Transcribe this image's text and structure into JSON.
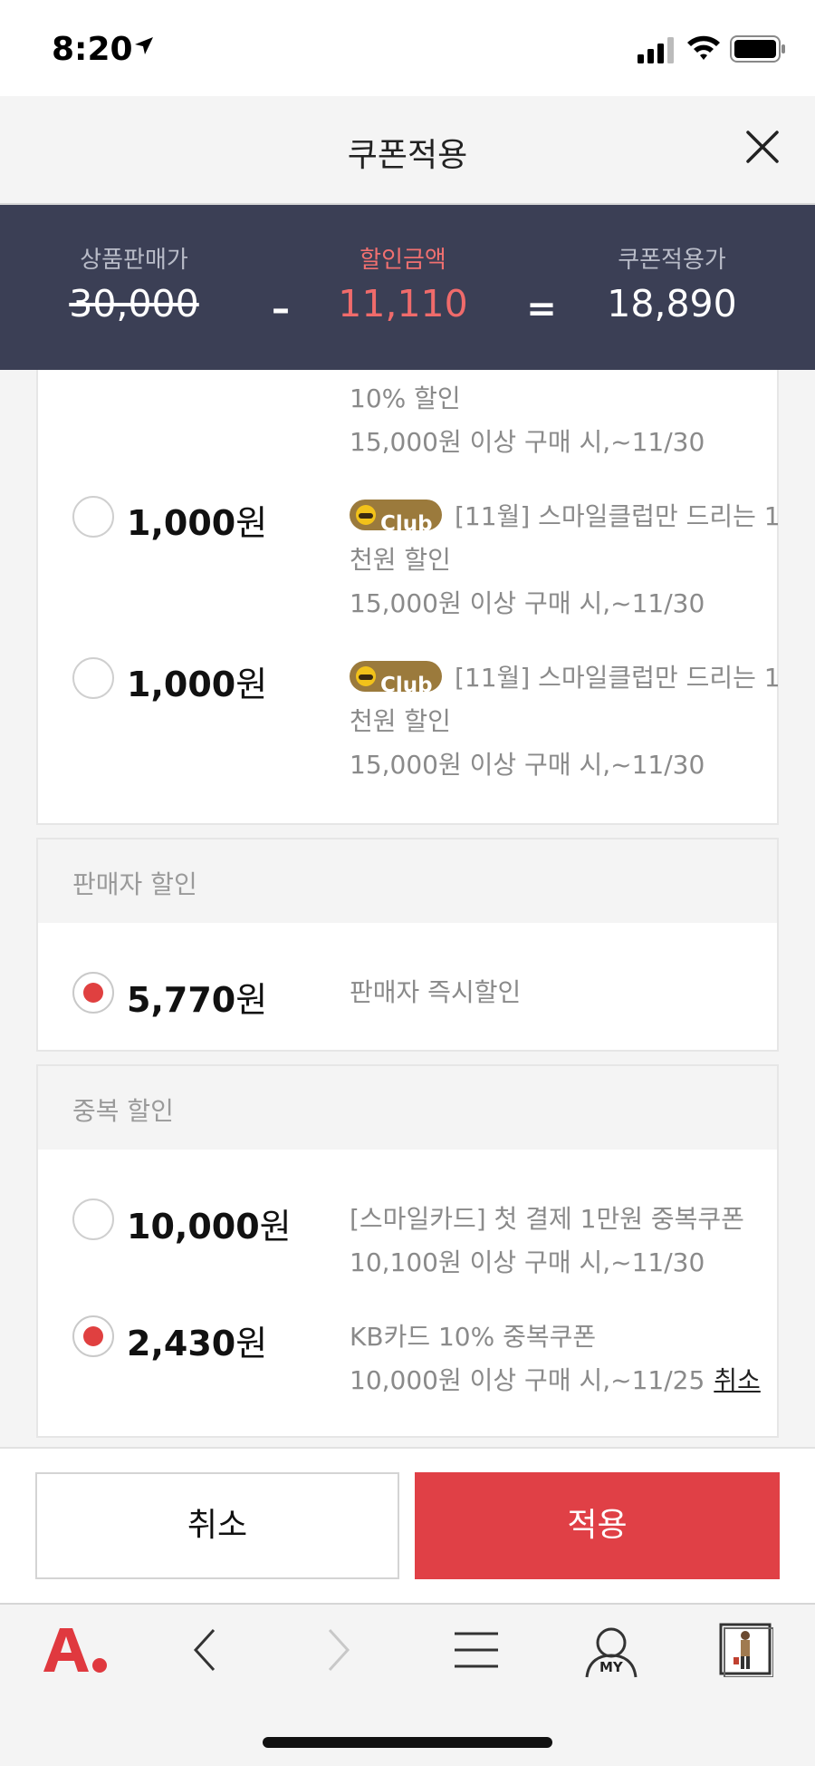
{
  "status": {
    "time": "8:20"
  },
  "header": {
    "title": "쿠폰적용"
  },
  "summary": {
    "original_label": "상품판매가",
    "original_value": "30,000",
    "minus": "–",
    "discount_label": "할인금액",
    "discount_value": "11,110",
    "equals": "=",
    "final_label": "쿠폰적용가",
    "final_value": "18,890"
  },
  "coupons": {
    "partial": {
      "line1": "10% 할인",
      "line2": "15,000원 이상 구매 시,~11/30"
    },
    "items": [
      {
        "amount": "1,000",
        "unit": "원",
        "badge": "Club",
        "title": "[11월] 스마일클럽만 드리는 1",
        "title2": "천원 할인",
        "cond": "15,000원 이상 구매 시,~11/30"
      },
      {
        "amount": "1,000",
        "unit": "원",
        "badge": "Club",
        "title": "[11월] 스마일클럽만 드리는 1",
        "title2": "천원 할인",
        "cond": "15,000원 이상 구매 시,~11/30"
      }
    ]
  },
  "seller": {
    "heading": "판매자 할인",
    "amount": "5,770",
    "unit": "원",
    "desc": "판매자 즉시할인"
  },
  "duplicate": {
    "heading": "중복 할인",
    "items": [
      {
        "amount": "10,000",
        "unit": "원",
        "title": "[스마일카드] 첫 결제 1만원 중복쿠폰",
        "cond": "10,100원 이상 구매 시,~11/30"
      },
      {
        "amount": "2,430",
        "unit": "원",
        "title": "KB카드 10% 중복쿠폰",
        "cond": "10,000원 이상 구매 시,~11/25",
        "cancel": "취소"
      }
    ]
  },
  "buttons": {
    "cancel": "취소",
    "apply": "적용"
  },
  "toolbar": {
    "my_label": "MY"
  },
  "colors": {
    "summary_bg": "#3b3f55",
    "accent_red": "#e04046",
    "club_gold": "#9b7a3c"
  }
}
